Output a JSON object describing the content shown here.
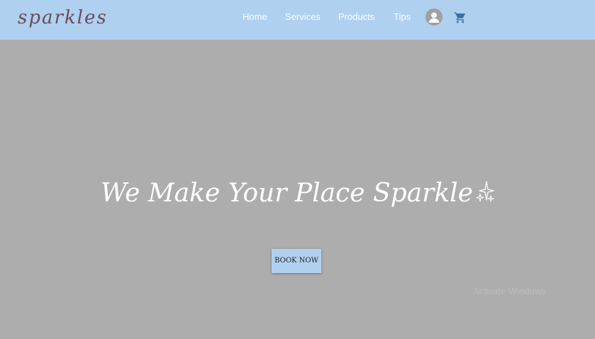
{
  "brand": {
    "logo_text": "sparkles",
    "logo_color": "#6a4a5a"
  },
  "nav": {
    "background": "#b0d0f0",
    "items": [
      {
        "label": "Home"
      },
      {
        "label": "Services"
      },
      {
        "label": "Products"
      },
      {
        "label": "Tips"
      }
    ],
    "account_icon": "user-avatar-icon",
    "cart_icon": "shopping-cart-icon",
    "cart_color": "#3a6fb0"
  },
  "hero": {
    "background": "#adadad",
    "title": "We Make Your Place Sparkle",
    "title_icon": "sparkles-icon",
    "cta_label": "BOOK NOW"
  },
  "watermark": {
    "text": "Activate Windows"
  }
}
